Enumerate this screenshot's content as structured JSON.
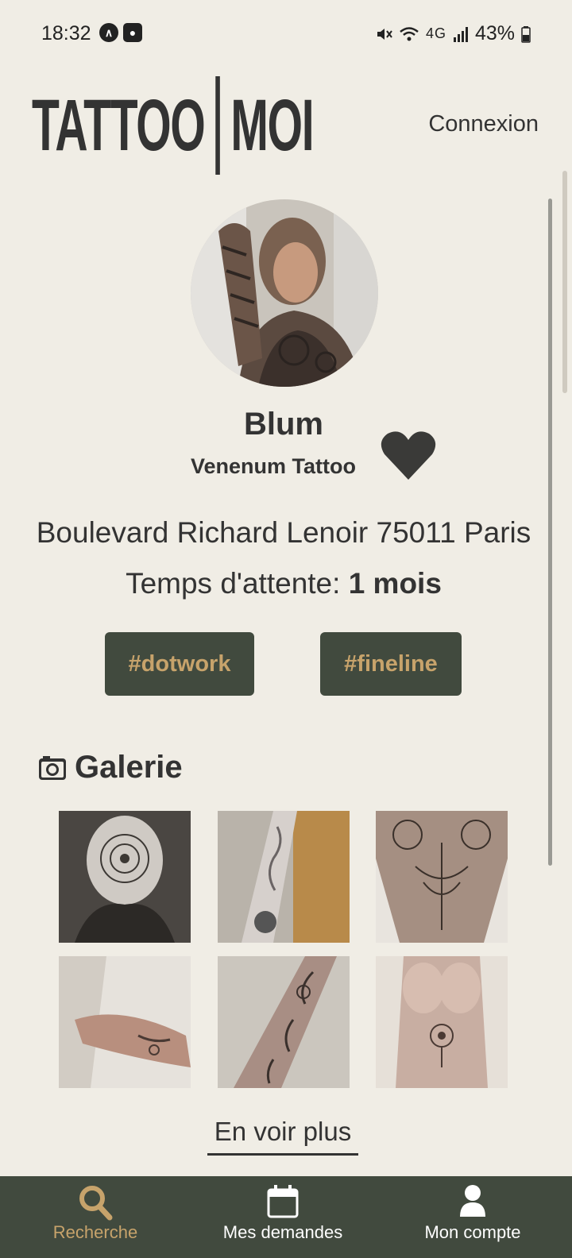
{
  "status_bar": {
    "time": "18:32",
    "network": "4G",
    "battery": "43%"
  },
  "header": {
    "logo_left": "TATTOO",
    "logo_right": "MOI",
    "login_label": "Connexion"
  },
  "artist": {
    "name": "Blum",
    "studio": "Venenum Tattoo",
    "address": "Boulevard Richard Lenoir 75011 Paris",
    "wait_label": "Temps d'attente:",
    "wait_value": "1 mois",
    "tags": [
      "#dotwork",
      "#fineline"
    ]
  },
  "gallery": {
    "title": "Galerie",
    "more_label": "En voir plus",
    "images": [
      "head-mandala",
      "arm-sleeve",
      "back-ornamental",
      "hand-tattoo",
      "forearm-floral",
      "sternum-mandala"
    ]
  },
  "bottom_nav": [
    {
      "label": "Recherche",
      "icon": "search-icon",
      "active": true
    },
    {
      "label": "Mes demandes",
      "icon": "calendar-icon",
      "active": false
    },
    {
      "label": "Mon compte",
      "icon": "user-icon",
      "active": false
    }
  ],
  "colors": {
    "background": "#f0ede5",
    "accent": "#414a3e",
    "accent_text": "#c7a36b",
    "text": "#333333"
  }
}
